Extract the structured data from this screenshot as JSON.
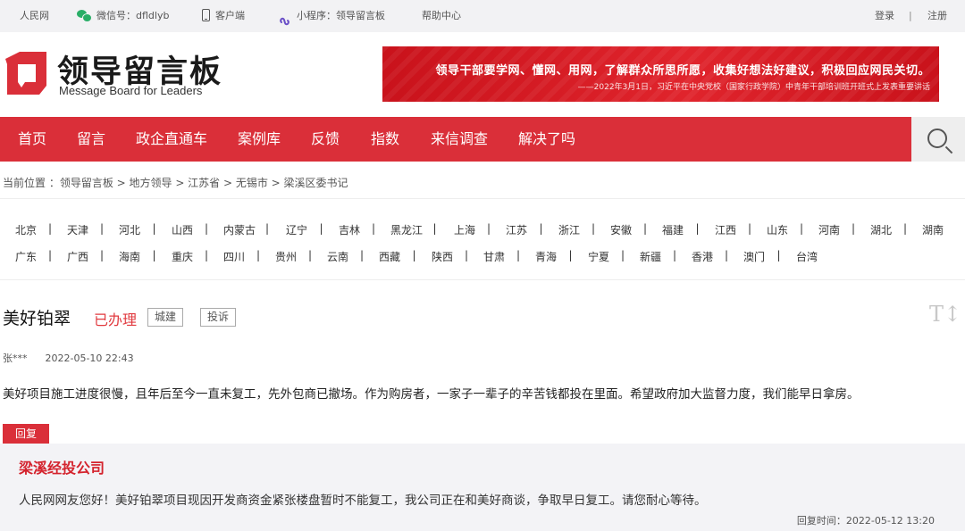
{
  "topbar": {
    "peoples_net": "人民网",
    "wechat": "微信号：dfldlyb",
    "client": "客户端",
    "miniprogram": "小程序：领导留言板",
    "help": "帮助中心",
    "login": "登录",
    "separator": "|",
    "register": "注册"
  },
  "header": {
    "logo_title": "领导留言板",
    "logo_sub": "Message Board for Leaders",
    "banner_line1": "领导干部要学网、懂网、用网，了解群众所思所愿，收集好想法好建议，积极回应网民关切。",
    "banner_line2": "——2022年3月1日，习近平在中央党校（国家行政学院）中青年干部培训班开班式上发表重要讲话"
  },
  "nav": {
    "items": [
      "首页",
      "留言",
      "政企直通车",
      "案例库",
      "反馈",
      "指数",
      "来信调查",
      "解决了吗"
    ]
  },
  "breadcrumb": "当前位置 ：领导留言板 > 地方领导 > 江苏省 > 无锡市 > 梁溪区委书记",
  "provinces": {
    "row1": [
      "北京",
      "天津",
      "河北",
      "山西",
      "内蒙古",
      "辽宁",
      "吉林",
      "黑龙江",
      "上海",
      "江苏",
      "浙江",
      "安徽",
      "福建",
      "江西",
      "山东",
      "河南",
      "湖北",
      "湖南"
    ],
    "row2": [
      "广东",
      "广西",
      "海南",
      "重庆",
      "四川",
      "贵州",
      "云南",
      "西藏",
      "陕西",
      "甘肃",
      "青海",
      "宁夏",
      "新疆",
      "香港",
      "澳门",
      "台湾"
    ]
  },
  "message": {
    "title": "美好铂翠",
    "status": "已办理",
    "tags": [
      "城建",
      "投诉"
    ],
    "font_toggle": "T↕",
    "author": "张***",
    "time": "2022-05-10 22:43",
    "body": "美好项目施工进度很慢，且年后至今一直未复工，先外包商已撤场。作为购房者，一家子一辈子的辛苦钱都投在里面。希望政府加大监督力度，我们能早日拿房。"
  },
  "reply": {
    "badge": "回复",
    "org": "梁溪经投公司",
    "body": "人民网网友您好！美好铂翠项目现因开发商资金紧张楼盘暂时不能复工，我公司正在和美好商谈，争取早日复工。请您耐心等待。",
    "time": "回复时间：2022-05-12 13:20"
  },
  "colors": {
    "brand_red": "#da2f39",
    "status_red": "#e13a3f",
    "reply_org_red": "#d4232d",
    "wechat_green": "#2aae67",
    "miniprogram_purple": "#6a4fc7"
  }
}
